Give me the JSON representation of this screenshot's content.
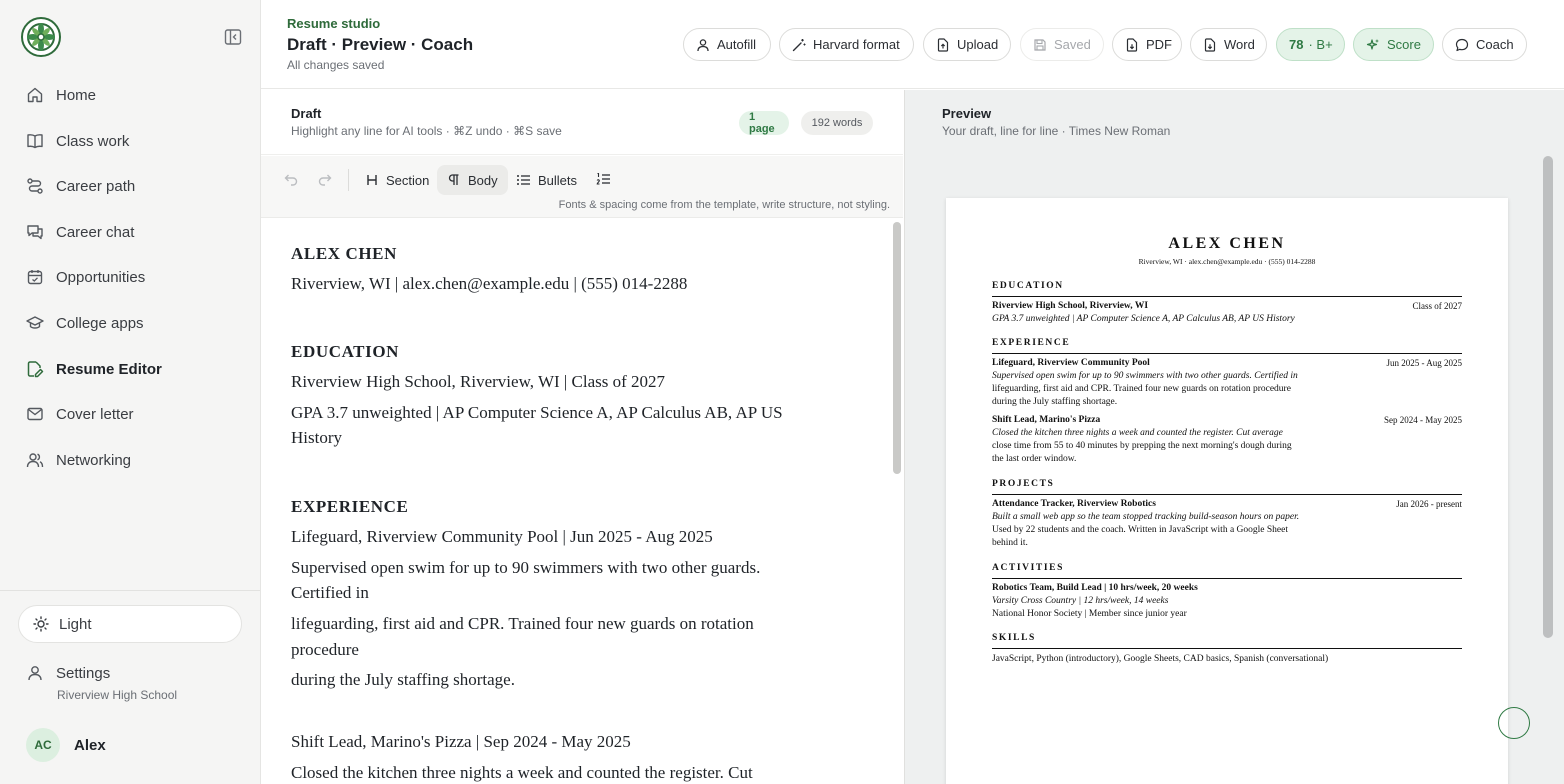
{
  "sidebar": {
    "items": [
      {
        "label": "Home",
        "icon": "home-icon"
      },
      {
        "label": "Class work",
        "icon": "book-icon"
      },
      {
        "label": "Career path",
        "icon": "route-icon"
      },
      {
        "label": "Career chat",
        "icon": "chat-icon"
      },
      {
        "label": "Opportunities",
        "icon": "calendar-icon"
      },
      {
        "label": "College apps",
        "icon": "graduation-cap-icon"
      },
      {
        "label": "Resume Editor",
        "icon": "file-edit-icon"
      },
      {
        "label": "Cover letter",
        "icon": "mail-icon"
      },
      {
        "label": "Networking",
        "icon": "people-icon"
      }
    ],
    "active": "Resume Editor",
    "theme_label": "Light",
    "settings_label": "Settings",
    "settings_sub": "Riverview High School",
    "user_initials": "AC",
    "user_name": "Alex"
  },
  "header": {
    "eyebrow": "Resume studio",
    "title": "Draft · Preview · Coach",
    "status": "All changes saved",
    "buttons": {
      "autofill": "Autofill",
      "harvard": "Harvard format",
      "upload": "Upload",
      "saved": "Saved",
      "pdf": "PDF",
      "word": "Word",
      "score_value": "78",
      "score_grade": "· B+",
      "score": "Score",
      "coach": "Coach"
    }
  },
  "draft": {
    "title": "Draft",
    "subtitle": "Highlight any line for AI tools · ⌘Z undo · ⌘S save",
    "pages_badge": "1 page",
    "words_badge": "192 words",
    "toolbar": {
      "section": "Section",
      "body": "Body",
      "bullets": "Bullets",
      "note": "Fonts & spacing come from the template, write structure, not styling."
    },
    "lines": [
      "ALEX CHEN",
      "Riverview, WI | alex.chen@example.edu | (555) 014-2288",
      "EDUCATION",
      "Riverview High School, Riverview, WI | Class of 2027",
      "GPA 3.7 unweighted | AP Computer Science A, AP Calculus AB, AP US",
      "History",
      "EXPERIENCE",
      "Lifeguard, Riverview Community Pool | Jun 2025 - Aug 2025",
      "Supervised open swim for up to 90 swimmers with two other guards.",
      "Certified in",
      "lifeguarding, first aid and CPR. Trained four new guards on rotation",
      "procedure",
      "during the July staffing shortage.",
      "Shift Lead, Marino's Pizza | Sep 2024 - May 2025",
      "Closed the kitchen three nights a week and counted the register. Cut"
    ]
  },
  "preview": {
    "title": "Preview",
    "subtitle": "Your draft, line for line · Times New Roman",
    "resume": {
      "name": "ALEX CHEN",
      "contact": "Riverview, WI · alex.chen@example.edu · (555) 014-2288",
      "education_h": "EDUCATION",
      "edu_school": "Riverview High School, Riverview, WI",
      "edu_date": "Class of 2027",
      "edu_gpa": "GPA 3.7 unweighted | AP Computer Science A, AP Calculus AB, AP US History",
      "experience_h": "EXPERIENCE",
      "job1_title": "Lifeguard, Riverview Community Pool",
      "job1_date": "Jun 2025 - Aug 2025",
      "job1_l1": "Supervised open swim for up to 90 swimmers with two other guards. Certified in",
      "job1_l2": "lifeguarding, first aid and CPR. Trained four new guards on rotation procedure",
      "job1_l3": "during the July staffing shortage.",
      "job2_title": "Shift Lead, Marino's Pizza",
      "job2_date": "Sep 2024 - May 2025",
      "job2_l1": "Closed the kitchen three nights a week and counted the register. Cut average",
      "job2_l2": "close time from 55 to 40 minutes by prepping the next morning's dough during",
      "job2_l3": "the last order window.",
      "projects_h": "PROJECTS",
      "proj_title": "Attendance Tracker, Riverview Robotics",
      "proj_date": "Jan 2026 - present",
      "proj_l1": "Built a small web app so the team stopped tracking build-season hours on paper.",
      "proj_l2": "Used by 22 students and the coach. Written in JavaScript with a Google Sheet",
      "proj_l3": "behind it.",
      "activities_h": "ACTIVITIES",
      "act_l1": "Robotics Team, Build Lead | 10 hrs/week, 20 weeks",
      "act_l2": "Varsity Cross Country | 12 hrs/week, 14 weeks",
      "act_l3": "National Honor Society | Member since junior year",
      "skills_h": "SKILLS",
      "skills_l1": "JavaScript, Python (introductory), Google Sheets, CAD basics, Spanish (conversational)"
    }
  },
  "colors": {
    "accent": "#2f7a44",
    "accent_bg": "#e4f3e8",
    "sidebar_bg": "#f5f5f4",
    "preview_bg": "#eef0f0"
  }
}
